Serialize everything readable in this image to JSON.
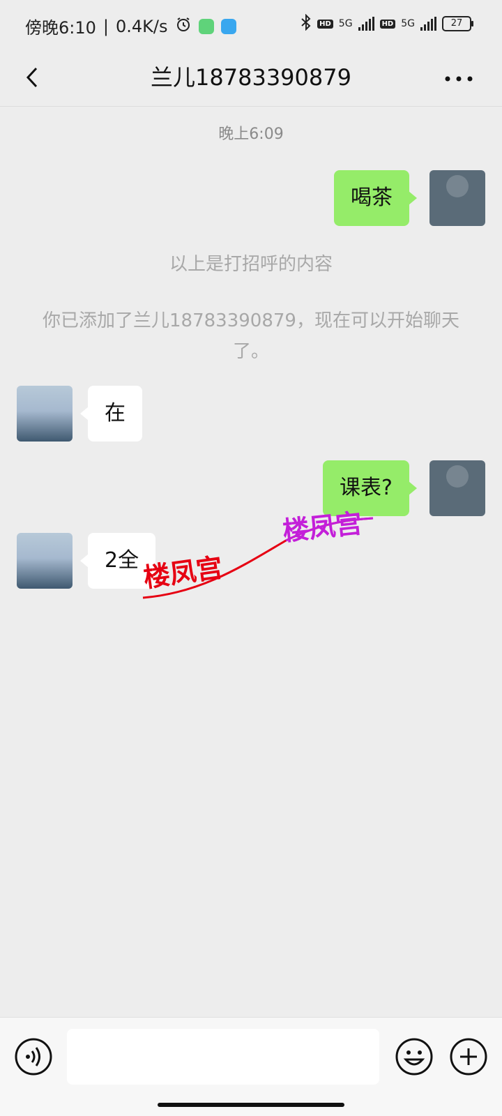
{
  "status_bar": {
    "time": "傍晚6:10",
    "net_speed": "0.4K/s",
    "battery": "27",
    "network_1": "5G",
    "network_2": "5G",
    "hd_1": "HD",
    "hd_2": "HD",
    "icons": [
      "alarm-icon",
      "app-green-icon",
      "app-blue-icon",
      "bluetooth-icon",
      "signal-icon",
      "battery-icon"
    ]
  },
  "header": {
    "title": "兰儿18783390879",
    "back_icon": "back-icon",
    "more_icon": "more-icon"
  },
  "chat": {
    "timestamp": "晚上6:09",
    "system_greeting": "以上是打招呼的内容",
    "system_added": "你已添加了兰儿18783390879，现在可以开始聊天了。",
    "messages": [
      {
        "side": "out",
        "text": "喝茶"
      },
      {
        "side": "in",
        "text": "在"
      },
      {
        "side": "out",
        "text": "课表?"
      },
      {
        "side": "in",
        "text": "2全"
      }
    ]
  },
  "watermarks": [
    "楼凤宫",
    "楼凤宫"
  ],
  "input_bar": {
    "placeholder": "",
    "voice_icon": "voice-icon",
    "emoji_icon": "emoji-icon",
    "plus_icon": "plus-icon"
  },
  "colors": {
    "background": "#ededed",
    "outgoing_bubble": "#95ec69",
    "incoming_bubble": "#ffffff",
    "watermark_red": "#e60012",
    "watermark_purple": "#c31fd9"
  }
}
